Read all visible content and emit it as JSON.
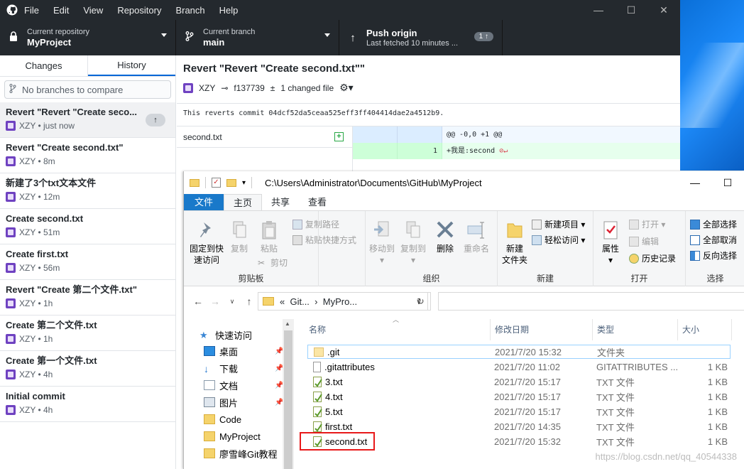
{
  "menu": [
    "File",
    "Edit",
    "View",
    "Repository",
    "Branch",
    "Help"
  ],
  "toolbar": {
    "repo_label": "Current repository",
    "repo_value": "MyProject",
    "branch_label": "Current branch",
    "branch_value": "main",
    "push_label": "Push origin",
    "push_sub": "Last fetched 10 minutes ...",
    "push_badge": "1 ↑"
  },
  "sidebar": {
    "tab_changes": "Changes",
    "tab_history": "History",
    "compare_placeholder": "No branches to compare",
    "commits": [
      {
        "title": "Revert \"Revert \"Create seco...",
        "meta": "XZY • just now"
      },
      {
        "title": "Revert \"Create second.txt\"",
        "meta": "XZY • 8m"
      },
      {
        "title": "新建了3个txt文本文件",
        "meta": "XZY • 12m"
      },
      {
        "title": "Create second.txt",
        "meta": "XZY • 51m"
      },
      {
        "title": "Create first.txt",
        "meta": "XZY • 56m"
      },
      {
        "title": "Revert \"Create 第二个文件.txt\"",
        "meta": "XZY • 1h"
      },
      {
        "title": "Create 第二个文件.txt",
        "meta": "XZY • 1h"
      },
      {
        "title": "Create 第一个文件.txt",
        "meta": "XZY • 4h"
      },
      {
        "title": "Initial commit",
        "meta": "XZY • 4h"
      }
    ]
  },
  "commit_detail": {
    "title": "Revert \"Revert \"Create second.txt\"\"",
    "author": "XZY",
    "sha": "f137739",
    "changed": "1 changed file",
    "message": "This reverts commit 04dcf52da5ceaa525eff3ff404414dae2a4512b9.",
    "file": "second.txt",
    "hunk": "@@ -0,0 +1 @@",
    "line_no": "1",
    "line_text": "+我是:second"
  },
  "explorer": {
    "path": "C:\\Users\\Administrator\\Documents\\GitHub\\MyProject",
    "tabs": [
      "文件",
      "主页",
      "共享",
      "查看"
    ],
    "ribbon": {
      "pin": "固定到快\n速访问",
      "copy": "复制",
      "paste": "粘贴",
      "copy_path": "复制路径",
      "paste_shortcut": "粘贴快捷方式",
      "cut": "剪切",
      "grp_clipboard": "剪贴板",
      "move_to": "移动到",
      "copy_to": "复制到",
      "delete": "删除",
      "rename": "重命名",
      "grp_organize": "组织",
      "new_folder": "新建\n文件夹",
      "new_item": "新建项目",
      "easy_access": "轻松访问",
      "grp_new": "新建",
      "properties": "属性",
      "open": "打开",
      "edit": "编辑",
      "history": "历史记录",
      "grp_open": "打开",
      "select_all": "全部选择",
      "select_none": "全部取消",
      "invert": "反向选择",
      "grp_select": "选择"
    },
    "addr_parts": [
      "«",
      "Git...",
      "›",
      "MyPro..."
    ],
    "tree": [
      {
        "label": "快速访问",
        "icon": "star-icon"
      },
      {
        "label": "桌面",
        "icon": "desktop-icon",
        "pinned": true
      },
      {
        "label": "下载",
        "icon": "download-icon",
        "pinned": true
      },
      {
        "label": "文档",
        "icon": "document-icon",
        "pinned": true
      },
      {
        "label": "图片",
        "icon": "picture-icon",
        "pinned": true
      },
      {
        "label": "Code",
        "icon": "folder-icon"
      },
      {
        "label": "MyProject",
        "icon": "folder-icon"
      },
      {
        "label": "廖雪峰Git教程",
        "icon": "folder-icon"
      }
    ],
    "columns": [
      "名称",
      "修改日期",
      "类型",
      "大小"
    ],
    "files": [
      {
        "name": ".git",
        "date": "2021/7/20 15:32",
        "type": "文件夹",
        "size": ""
      },
      {
        "name": ".gitattributes",
        "date": "2021/7/20 11:02",
        "type": "GITATTRIBUTES ...",
        "size": "1 KB"
      },
      {
        "name": "3.txt",
        "date": "2021/7/20 15:17",
        "type": "TXT 文件",
        "size": "1 KB"
      },
      {
        "name": "4.txt",
        "date": "2021/7/20 15:17",
        "type": "TXT 文件",
        "size": "1 KB"
      },
      {
        "name": "5.txt",
        "date": "2021/7/20 15:17",
        "type": "TXT 文件",
        "size": "1 KB"
      },
      {
        "name": "first.txt",
        "date": "2021/7/20 14:35",
        "type": "TXT 文件",
        "size": "1 KB"
      },
      {
        "name": "second.txt",
        "date": "2021/7/20 15:32",
        "type": "TXT 文件",
        "size": "1 KB"
      }
    ],
    "watermark": "https://blog.csdn.net/qq_40544338"
  }
}
